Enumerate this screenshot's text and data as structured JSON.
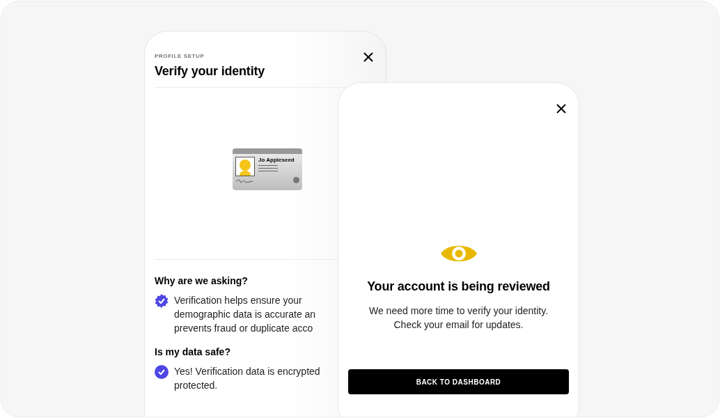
{
  "setup_card": {
    "eyebrow": "PROFILE SETUP",
    "title": "Verify your identity",
    "id_card": {
      "name": "Jo Appleseed"
    },
    "sections": [
      {
        "heading": "Why are we asking?",
        "kind": "badge",
        "lines": [
          "Verification helps ensure your",
          "demographic data is accurate an",
          "prevents fraud or duplicate acco"
        ]
      },
      {
        "heading": "Is my data safe?",
        "kind": "circle",
        "lines": [
          "Yes! Verification data is encrypted",
          "protected."
        ]
      }
    ]
  },
  "review_card": {
    "title": "Your account is being reviewed",
    "body_lines": [
      "We need more time to verify your identity.",
      "Check your email for updates."
    ],
    "button": "BACK TO DASHBOARD"
  }
}
